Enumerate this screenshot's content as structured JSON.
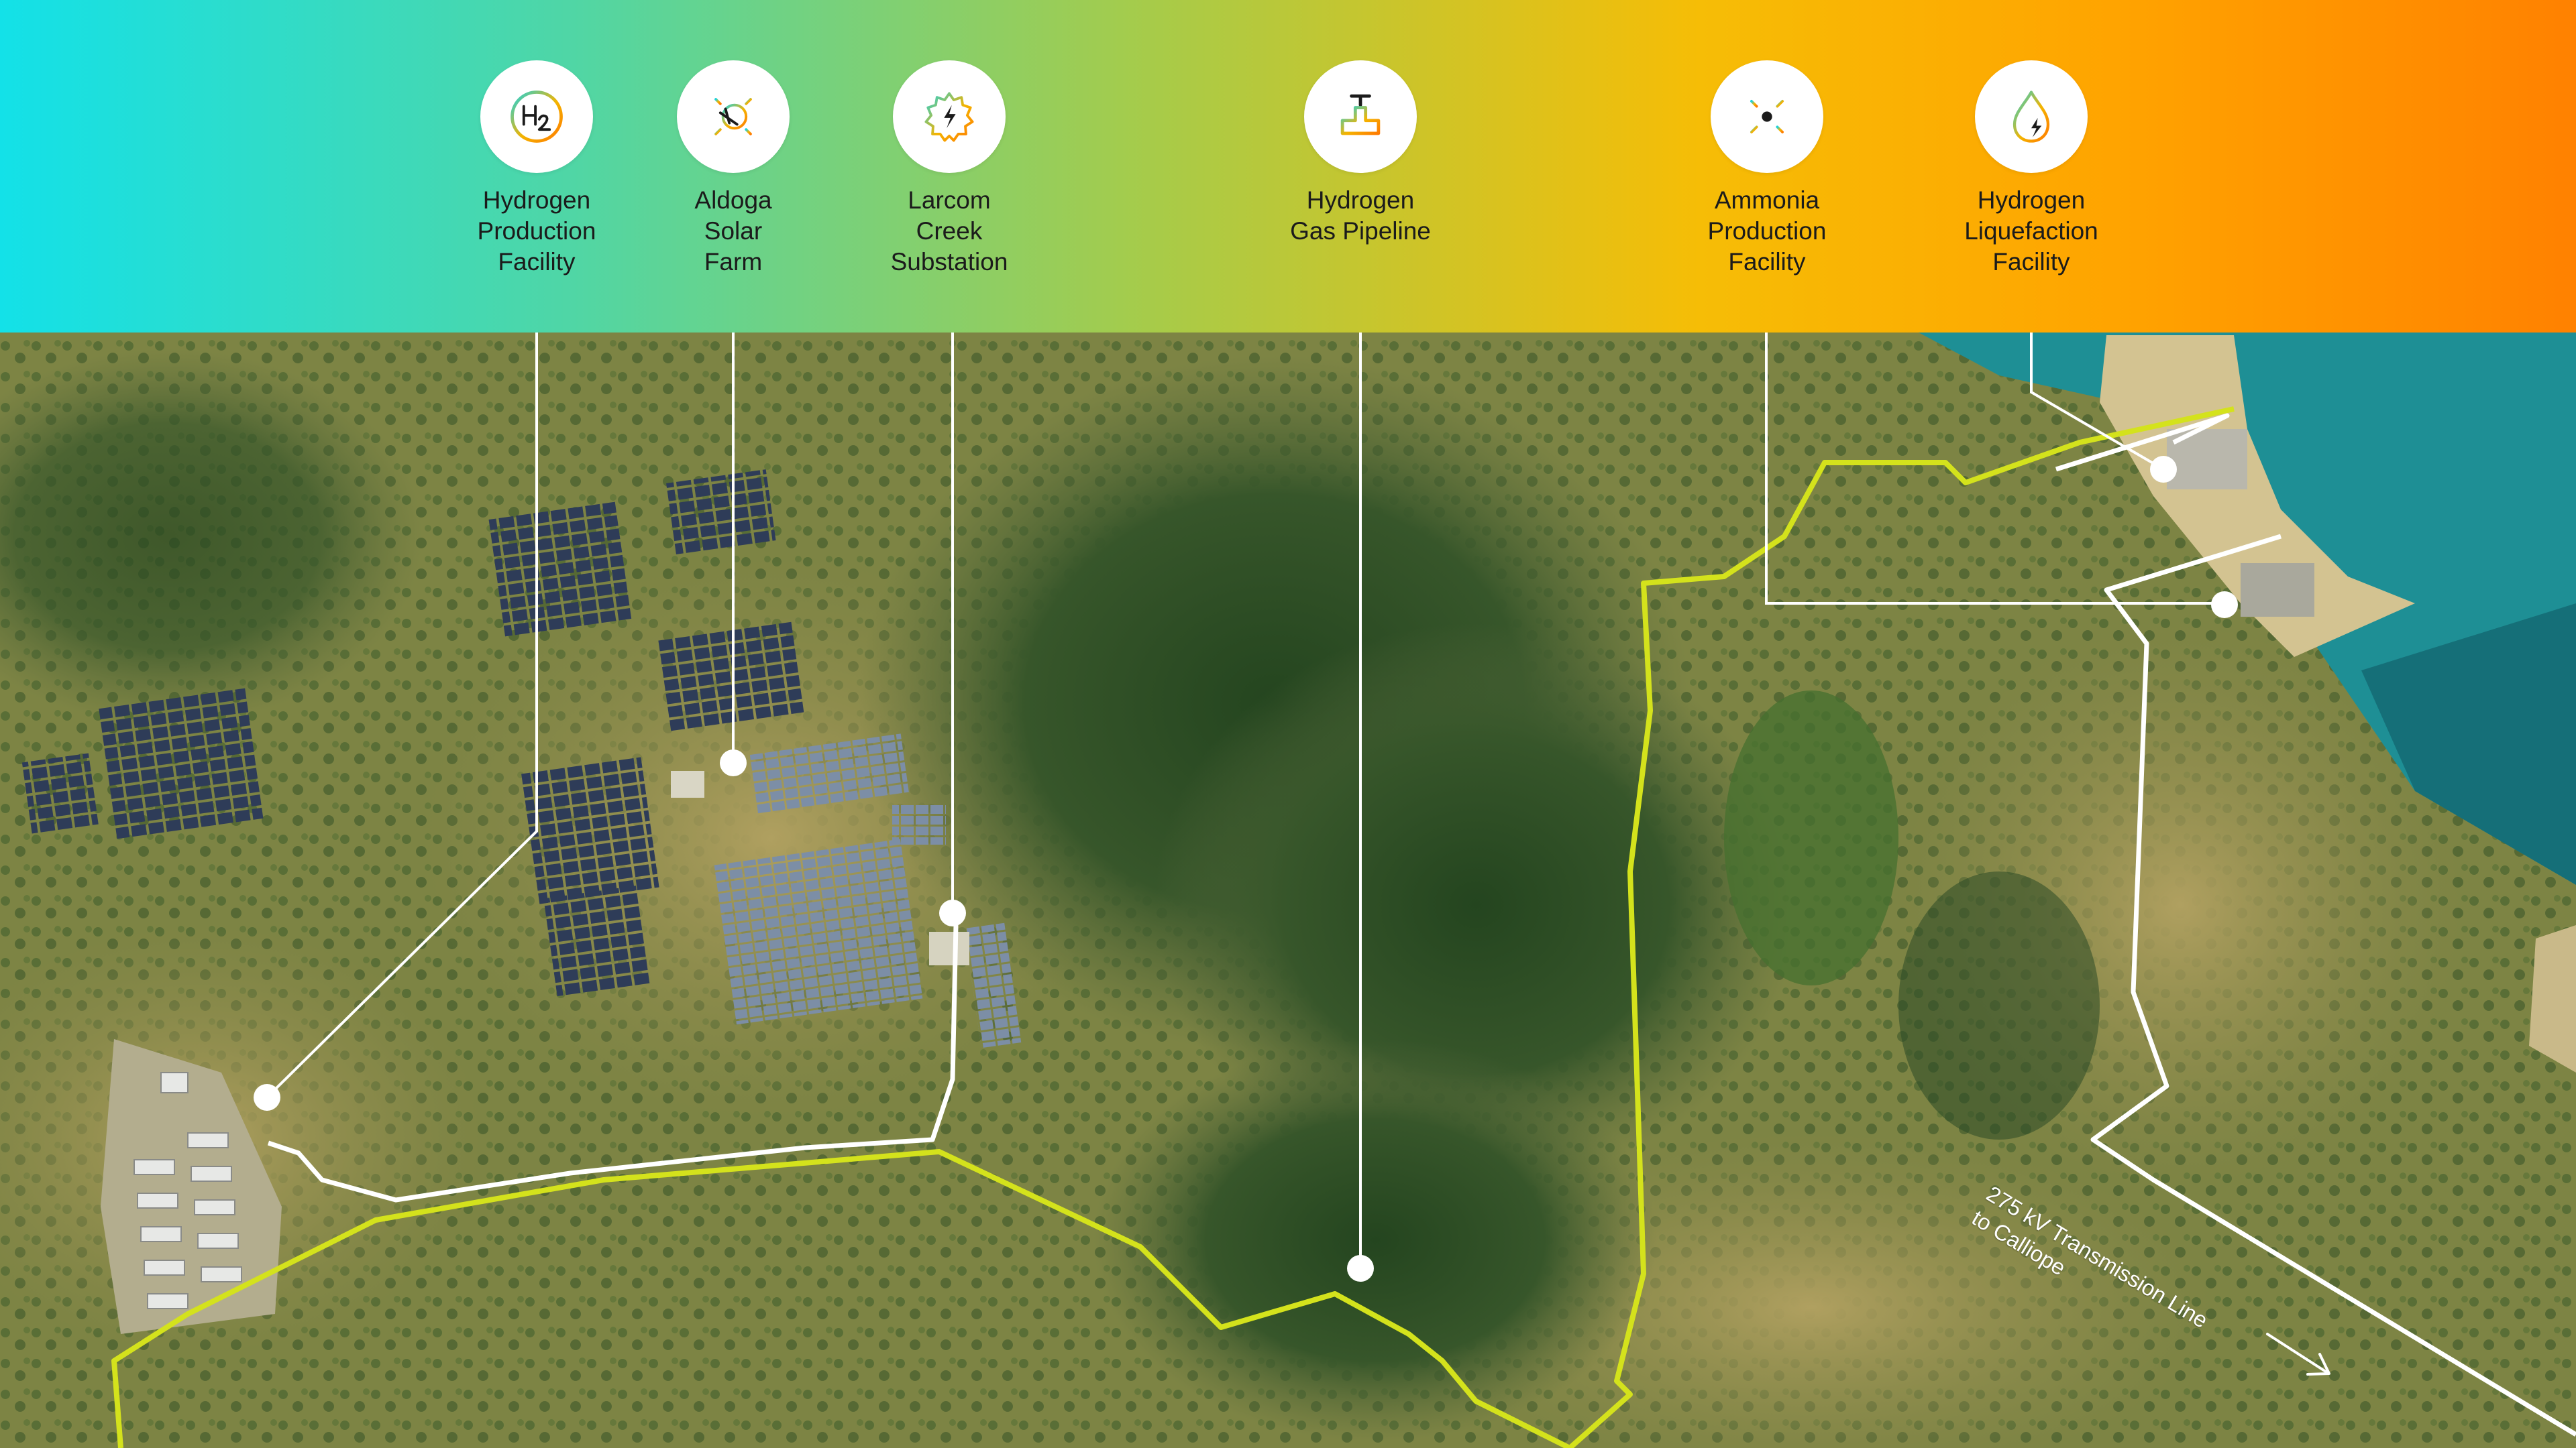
{
  "header": {
    "gradient": [
      "#13e1e8",
      "#4fd6a6",
      "#a8cb48",
      "#f6bd06",
      "#ffa400",
      "#ff8100"
    ]
  },
  "facilities": [
    {
      "id": "hydrogen-production",
      "label": "Hydrogen\nProduction\nFacility",
      "icon": "h2-icon"
    },
    {
      "id": "aldoga-solar",
      "label": "Aldoga\nSolar\nFarm",
      "icon": "solar-farm-icon"
    },
    {
      "id": "larcom-substation",
      "label": "Larcom\nCreek\nSubstation",
      "icon": "substation-gear-icon"
    },
    {
      "id": "gas-pipeline",
      "label": "Hydrogen\nGas Pipeline",
      "icon": "pipeline-icon"
    },
    {
      "id": "ammonia-production",
      "label": "Ammonia\nProduction\nFacility",
      "icon": "ammonia-molecule-icon"
    },
    {
      "id": "liquefaction",
      "label": "Hydrogen\nLiquefaction\nFacility",
      "icon": "liquid-drop-bolt-icon"
    }
  ],
  "map": {
    "transmission_label": "275 kV Transmission Line\nto Calliope",
    "pipeline_color": "#d4e21c",
    "leader_color": "#ffffff",
    "water_color": "#1e8f95"
  }
}
